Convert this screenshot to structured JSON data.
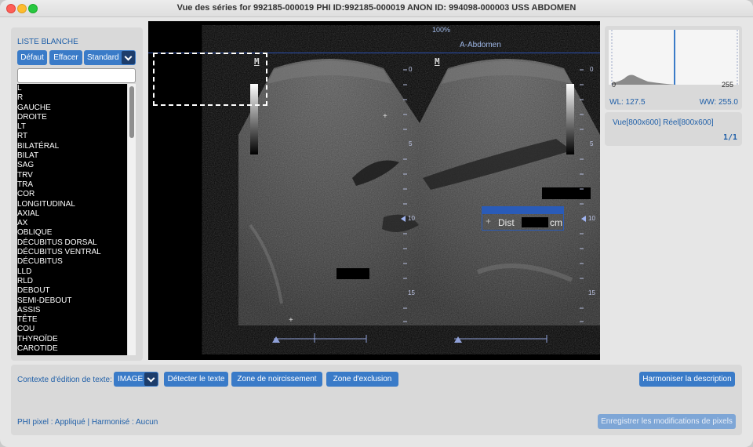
{
  "window": {
    "title": "Vue des séries for 992185-000019 PHI ID:992185-000019 ANON ID: 994098-000003 USS ABDOMEN"
  },
  "whitelist": {
    "title": "LISTE BLANCHE",
    "default_label": "Défaut",
    "clear_label": "Effacer",
    "preset_selected": "Standard",
    "filter_value": "",
    "items": [
      "L",
      "R",
      "GAUCHE",
      "DROITE",
      "LT",
      "RT",
      "BILATÉRAL",
      "BILAT",
      "SAG",
      "TRV",
      "TRA",
      "COR",
      "LONGITUDINAL",
      "AXIAL",
      "AX",
      "OBLIQUE",
      "DÉCUBITUS DORSAL",
      "DÉCUBITUS VENTRAL",
      "DÉCUBITUS",
      "LLD",
      "RLD",
      "DEBOUT",
      "SEMI-DEBOUT",
      "ASSIS",
      "TÊTE",
      "COU",
      "THYROÏDE",
      "CAROTIDE"
    ]
  },
  "viewer": {
    "zoom": "100%",
    "image_title": "A-Abdomen",
    "marker_left": "M",
    "marker_right": "M",
    "depth_labels": [
      "0",
      "5",
      "10",
      "15"
    ],
    "measurement_label": "Dist",
    "measurement_unit": "cm"
  },
  "histogram": {
    "min_label": "0",
    "max_label": "255",
    "wl": "WL: 127.5",
    "ww": "WW: 255.0"
  },
  "info": {
    "view_size": "Vue[800x600] Réel[800x600]",
    "frame_count": "1/1"
  },
  "bottom": {
    "context_label": "Contexte d'édition de texte:",
    "context_selected": "IMAGE",
    "detect_label": "Détecter le texte",
    "blacken_label": "Zone de noircissement",
    "exclude_label": "Zone d'exclusion",
    "harmonize_label": "Harmoniser la description",
    "phi_status": "PHI pixel : Appliqué | Harmonisé : Aucun",
    "save_label": "Enregistrer les modifications de pixels"
  },
  "colors": {
    "accent": "#3a7bc8",
    "label_blue": "#1f5fa8",
    "histogram_marker": "#3a7bc8"
  }
}
